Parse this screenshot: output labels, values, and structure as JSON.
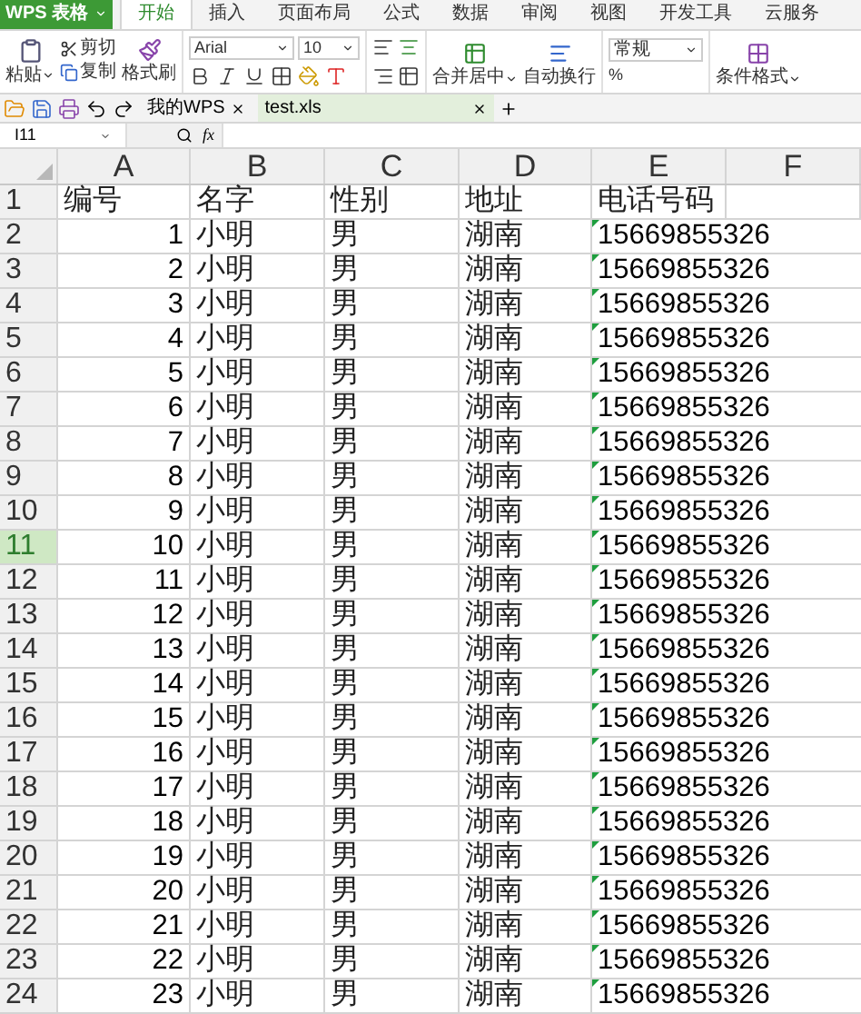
{
  "app_button": {
    "label": "WPS 表格"
  },
  "menu_tabs": [
    {
      "label": "开始",
      "selected": true
    },
    {
      "label": "插入",
      "selected": false
    },
    {
      "label": "页面布局",
      "selected": false
    },
    {
      "label": "公式",
      "selected": false
    },
    {
      "label": "数据",
      "selected": false
    },
    {
      "label": "审阅",
      "selected": false
    },
    {
      "label": "视图",
      "selected": false
    },
    {
      "label": "开发工具",
      "selected": false
    },
    {
      "label": "云服务",
      "selected": false
    }
  ],
  "ribbon": {
    "paste": "粘贴",
    "cut": "剪切",
    "copy": "复制",
    "format_painter": "格式刷",
    "font": "Arial",
    "size": "10",
    "merge": "合并居中",
    "wrap": "自动换行",
    "number_format": "常规",
    "percent": "%",
    "conditional": "条件格式"
  },
  "doc_tabs": [
    {
      "label": "我的WPS",
      "selected": false
    },
    {
      "label": "test.xls",
      "selected": true
    }
  ],
  "formula_bar": {
    "name_box": "I11",
    "fx": "fx"
  },
  "columns": [
    "A",
    "B",
    "C",
    "D",
    "E",
    "F"
  ],
  "rows": [
    {
      "header": "1",
      "kind": "title",
      "selected": false,
      "cells": [
        "编号",
        "名字",
        "性别",
        "地址",
        "电话号码"
      ]
    },
    {
      "header": "2",
      "kind": "record",
      "selected": false,
      "cells": [
        "1",
        "小明",
        "男",
        "湖南",
        "15669855326"
      ]
    },
    {
      "header": "3",
      "kind": "record",
      "selected": false,
      "cells": [
        "2",
        "小明",
        "男",
        "湖南",
        "15669855326"
      ]
    },
    {
      "header": "4",
      "kind": "record",
      "selected": false,
      "cells": [
        "3",
        "小明",
        "男",
        "湖南",
        "15669855326"
      ]
    },
    {
      "header": "5",
      "kind": "record",
      "selected": false,
      "cells": [
        "4",
        "小明",
        "男",
        "湖南",
        "15669855326"
      ]
    },
    {
      "header": "6",
      "kind": "record",
      "selected": false,
      "cells": [
        "5",
        "小明",
        "男",
        "湖南",
        "15669855326"
      ]
    },
    {
      "header": "7",
      "kind": "record",
      "selected": false,
      "cells": [
        "6",
        "小明",
        "男",
        "湖南",
        "15669855326"
      ]
    },
    {
      "header": "8",
      "kind": "record",
      "selected": false,
      "cells": [
        "7",
        "小明",
        "男",
        "湖南",
        "15669855326"
      ]
    },
    {
      "header": "9",
      "kind": "record",
      "selected": false,
      "cells": [
        "8",
        "小明",
        "男",
        "湖南",
        "15669855326"
      ]
    },
    {
      "header": "10",
      "kind": "record",
      "selected": false,
      "cells": [
        "9",
        "小明",
        "男",
        "湖南",
        "15669855326"
      ]
    },
    {
      "header": "11",
      "kind": "record",
      "selected": true,
      "cells": [
        "10",
        "小明",
        "男",
        "湖南",
        "15669855326"
      ]
    },
    {
      "header": "12",
      "kind": "record",
      "selected": false,
      "cells": [
        "11",
        "小明",
        "男",
        "湖南",
        "15669855326"
      ]
    },
    {
      "header": "13",
      "kind": "record",
      "selected": false,
      "cells": [
        "12",
        "小明",
        "男",
        "湖南",
        "15669855326"
      ]
    },
    {
      "header": "14",
      "kind": "record",
      "selected": false,
      "cells": [
        "13",
        "小明",
        "男",
        "湖南",
        "15669855326"
      ]
    },
    {
      "header": "15",
      "kind": "record",
      "selected": false,
      "cells": [
        "14",
        "小明",
        "男",
        "湖南",
        "15669855326"
      ]
    },
    {
      "header": "16",
      "kind": "record",
      "selected": false,
      "cells": [
        "15",
        "小明",
        "男",
        "湖南",
        "15669855326"
      ]
    },
    {
      "header": "17",
      "kind": "record",
      "selected": false,
      "cells": [
        "16",
        "小明",
        "男",
        "湖南",
        "15669855326"
      ]
    },
    {
      "header": "18",
      "kind": "record",
      "selected": false,
      "cells": [
        "17",
        "小明",
        "男",
        "湖南",
        "15669855326"
      ]
    },
    {
      "header": "19",
      "kind": "record",
      "selected": false,
      "cells": [
        "18",
        "小明",
        "男",
        "湖南",
        "15669855326"
      ]
    },
    {
      "header": "20",
      "kind": "record",
      "selected": false,
      "cells": [
        "19",
        "小明",
        "男",
        "湖南",
        "15669855326"
      ]
    },
    {
      "header": "21",
      "kind": "record",
      "selected": false,
      "cells": [
        "20",
        "小明",
        "男",
        "湖南",
        "15669855326"
      ]
    },
    {
      "header": "22",
      "kind": "record",
      "selected": false,
      "cells": [
        "21",
        "小明",
        "男",
        "湖南",
        "15669855326"
      ]
    },
    {
      "header": "23",
      "kind": "record",
      "selected": false,
      "cells": [
        "22",
        "小明",
        "男",
        "湖南",
        "15669855326"
      ]
    },
    {
      "header": "24",
      "kind": "record",
      "selected": false,
      "cells": [
        "23",
        "小明",
        "男",
        "湖南",
        "15669855326"
      ]
    }
  ]
}
